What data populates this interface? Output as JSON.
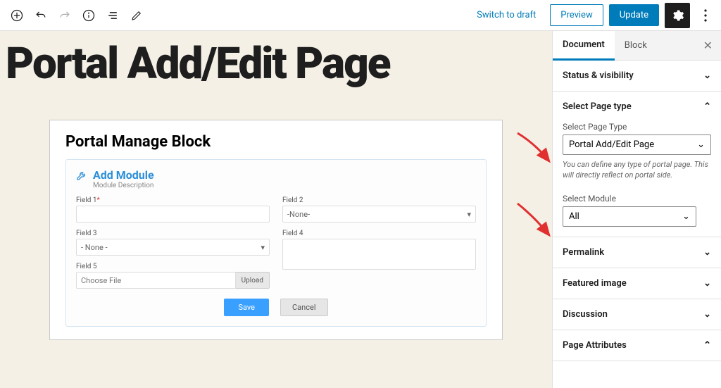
{
  "topbar": {
    "switch_label": "Switch to draft",
    "preview_label": "Preview",
    "update_label": "Update"
  },
  "canvas": {
    "title": "Portal Add/Edit Page",
    "block_title": "Portal Manage Block",
    "module": {
      "title": "Add Module",
      "desc": "Module Description",
      "field1_label": "Field 1",
      "field2_label": "Field 2",
      "field2_value": "-None-",
      "field3_label": "Field 3",
      "field3_value": "- None -",
      "field4_label": "Field 4",
      "field5_label": "Field 5",
      "field5_placeholder": "Choose File",
      "upload_label": "Upload",
      "save_label": "Save",
      "cancel_label": "Cancel"
    }
  },
  "sidebar": {
    "tabs": {
      "document": "Document",
      "block": "Block"
    },
    "panels": {
      "status": "Status & visibility",
      "page_type": "Select Page type",
      "page_type_label": "Select Page Type",
      "page_type_value": "Portal Add/Edit Page",
      "page_type_hint": "You can define any type of portal page. This will directly reflect on portal side.",
      "module_label": "Select Module",
      "module_value": "All",
      "permalink": "Permalink",
      "featured": "Featured image",
      "discussion": "Discussion",
      "attributes": "Page Attributes"
    }
  }
}
